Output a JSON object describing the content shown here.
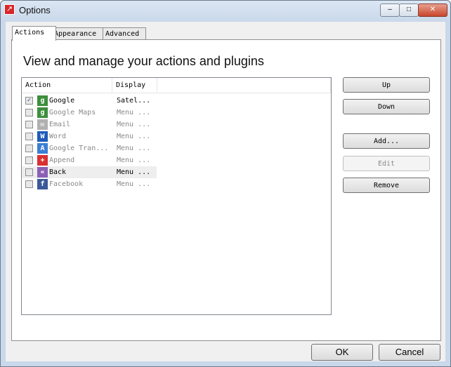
{
  "window": {
    "title": "Options",
    "minimize": "–",
    "maximize": "□",
    "close": "✕"
  },
  "tabs": [
    {
      "label": "Actions",
      "active": true
    },
    {
      "label": "Appearance"
    },
    {
      "label": "Advanced"
    }
  ],
  "heading": "View and manage your actions and plugins",
  "list": {
    "columns": [
      "Action",
      "Display"
    ],
    "rows": [
      {
        "action": "Google",
        "display": "Satel...",
        "checked": true,
        "enabled": true,
        "icon": "google-icon",
        "glyph": "g",
        "color": "#3c8f3c"
      },
      {
        "action": "Google Maps",
        "display": "Menu ...",
        "checked": false,
        "enabled": false,
        "icon": "google-maps-icon",
        "glyph": "g",
        "color": "#3c8f3c"
      },
      {
        "action": "Email",
        "display": "Menu ...",
        "checked": false,
        "enabled": false,
        "icon": "email-icon",
        "glyph": "✉",
        "color": "#b0b0b0"
      },
      {
        "action": "Word",
        "display": "Menu ...",
        "checked": false,
        "enabled": false,
        "icon": "word-icon",
        "glyph": "W",
        "color": "#1e5bb8"
      },
      {
        "action": "Google Tran...",
        "display": "Menu ...",
        "checked": false,
        "enabled": false,
        "icon": "google-translate-icon",
        "glyph": "A",
        "color": "#3a7fd5"
      },
      {
        "action": "Append",
        "display": "Menu ...",
        "checked": false,
        "enabled": false,
        "icon": "append-icon",
        "glyph": "+",
        "color": "#d83030"
      },
      {
        "action": "Back",
        "display": "Menu ...",
        "checked": false,
        "enabled": true,
        "selected": true,
        "icon": "back-icon",
        "glyph": "«",
        "color": "#8a5fb5"
      },
      {
        "action": "Facebook",
        "display": "Menu ...",
        "checked": false,
        "enabled": false,
        "icon": "facebook-icon",
        "glyph": "f",
        "color": "#3b5998"
      }
    ]
  },
  "buttons": {
    "up": "Up",
    "down": "Down",
    "add": "Add...",
    "edit": "Edit",
    "remove": "Remove",
    "ok": "OK",
    "cancel": "Cancel"
  }
}
